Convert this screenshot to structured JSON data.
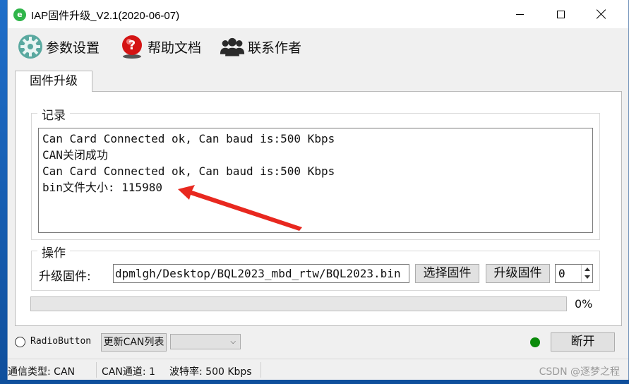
{
  "window": {
    "title": "IAP固件升级_V2.1(2020-06-07)",
    "app_icon_glyph": "e"
  },
  "toolbar": {
    "items": [
      {
        "label": "参数设置",
        "icon": "gear-icon"
      },
      {
        "label": "帮助文档",
        "icon": "help-icon"
      },
      {
        "label": "联系作者",
        "icon": "contacts-icon"
      }
    ]
  },
  "tabs": [
    {
      "label": "固件升级"
    }
  ],
  "log_group": {
    "title": "记录",
    "lines": [
      "Can Card Connected ok, Can baud is:500 Kbps",
      "CAN关闭成功",
      "Can Card Connected ok, Can baud is:500 Kbps",
      "bin文件大小: 115980"
    ]
  },
  "operation_group": {
    "title": "操作",
    "firmware_label": "升级固件:",
    "firmware_path": "dpmlgh/Desktop/BQL2023_mbd_rtw/BQL2023.bin",
    "select_button": "选择固件",
    "upgrade_button": "升级固件",
    "spin_value": "0"
  },
  "progress": {
    "value_percent": 0,
    "label": "0%"
  },
  "bottom": {
    "radio_label": "RadioButton",
    "refresh_button": "更新CAN列表",
    "combo_value": "",
    "disconnect_button": "断开"
  },
  "status": {
    "comm_type": "通信类型: CAN",
    "can_channel": "CAN通道: 1",
    "baud_rate": "波特率: 500 Kbps"
  },
  "watermark": "CSDN @逐梦之程",
  "colors": {
    "led": "#0a8a0a",
    "annotation_arrow": "#e8281f",
    "app_icon": "#2fb54a"
  }
}
